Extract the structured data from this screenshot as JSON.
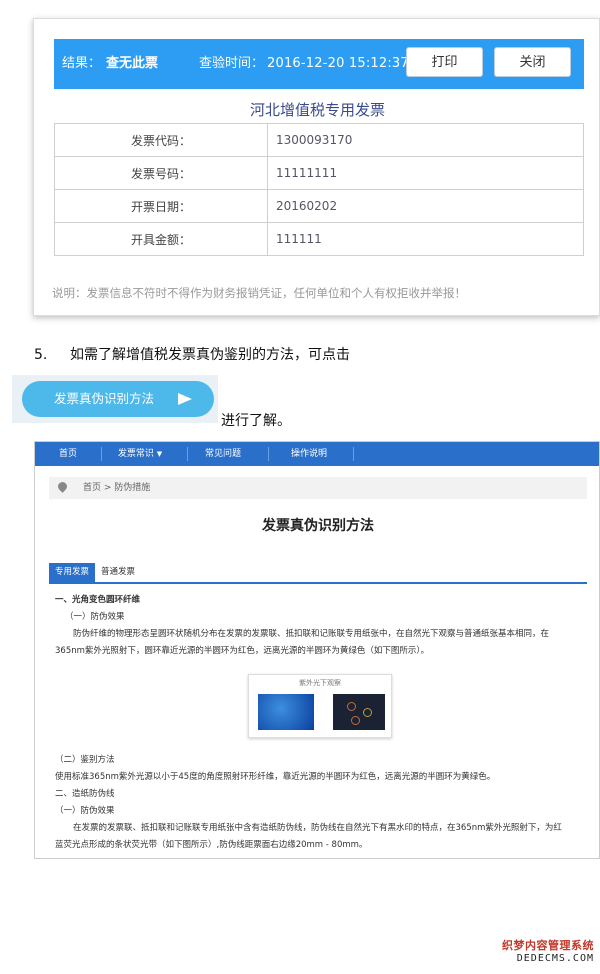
{
  "result_panel": {
    "result_label": "结果：",
    "result_value": "查无此票",
    "time_label": "查验时间：",
    "time_value": "2016-12-20 15:12:37",
    "print_button": "打印",
    "close_button": "关闭",
    "invoice_title": "河北增值税专用发票",
    "rows": [
      {
        "label": "发票代码：",
        "value": "1300093170"
      },
      {
        "label": "发票号码：",
        "value": "11111111"
      },
      {
        "label": "开票日期：",
        "value": "20160202"
      },
      {
        "label": "开具金额：",
        "value": "111111"
      }
    ],
    "note": "说明：发票信息不符时不得作为财务报销凭证，任何单位和个人有权拒收并举报！"
  },
  "step": {
    "number": "5.",
    "text": "如需了解增值税发票真伪鉴别的方法，可点击",
    "button_label": "发票真伪识别方法",
    "suffix": "进行了解。"
  },
  "site": {
    "nav": [
      "首页",
      "发票常识",
      "常见问题",
      "操作说明"
    ],
    "breadcrumb": "首页 > 防伪措施",
    "title": "发票真伪识别方法",
    "tabs": [
      "专用发票",
      "普通发票"
    ],
    "section1_title": "一、光角变色圆环纤维",
    "section1_sub": "（一）防伪效果",
    "section1_para1": "防伪纤维的物理形态呈圆环状随机分布在发票的发票联、抵扣联和记账联专用纸张中，在自然光下观察与普通纸张基本相同，在",
    "section1_para2": "365nm紫外光照射下，圆环靠近光源的半圆环为红色，远离光源的半圆环为黄绿色（如下图所示）。",
    "figure_caption": "紫外光下观察",
    "section1_sub2": "（二）鉴别方法",
    "section1_para3": "使用标准365nm紫外光源以小于45度的角度照射环形纤维，靠近光源的半圆环为红色，远离光源的半圆环为黄绿色。",
    "section2_title": "二、造纸防伪线",
    "section2_sub": "（一）防伪效果",
    "section2_para1": "在发票的发票联、抵扣联和记账联专用纸张中含有造纸防伪线，防伪线在自然光下有黑水印的特点，在365nm紫外光照射下，为红",
    "section2_para2": "蓝荧光点形成的条状荧光带（如下图所示）,防伪线距票面右边缘20mm - 80mm。"
  },
  "watermark": {
    "line1": "织梦内容管理系统",
    "line2": "DEDECMS.COM"
  }
}
